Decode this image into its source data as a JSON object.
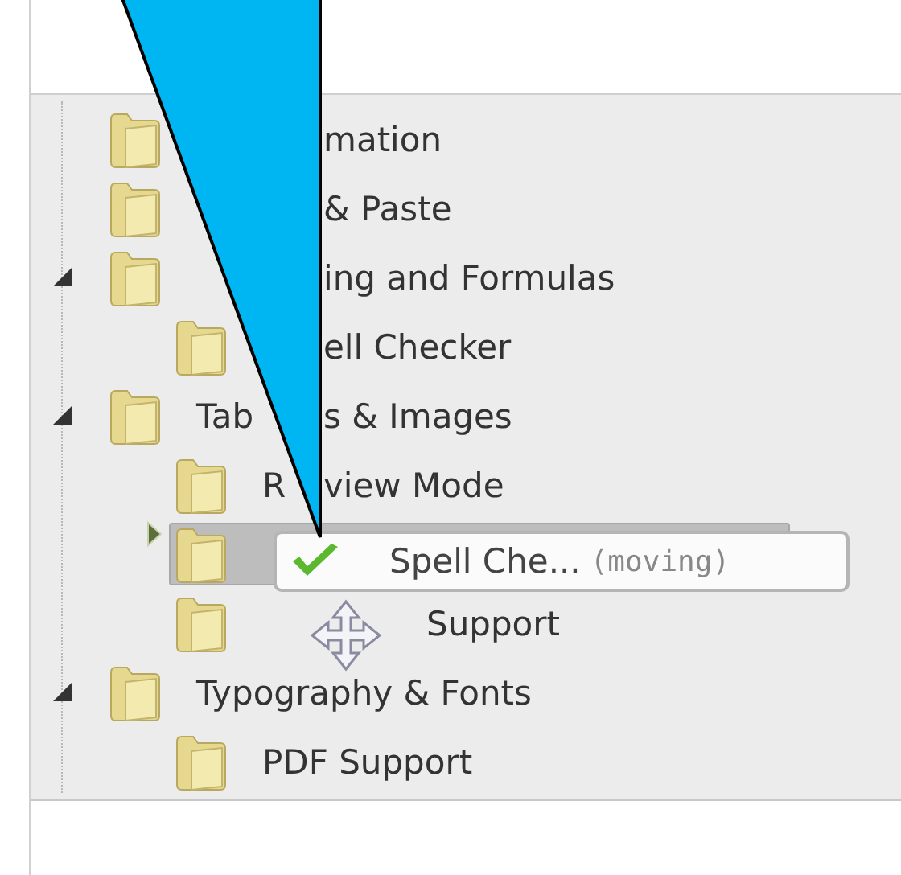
{
  "tree": {
    "items": [
      {
        "selected": false,
        "parts": [
          {
            "text": "mation",
            "kind": "tail"
          }
        ]
      },
      {
        "selected": false,
        "parts": [
          {
            "text": "& Paste",
            "kind": "tail"
          }
        ]
      },
      {
        "selected": false,
        "expanded": true,
        "parts": [
          {
            "text": "ing and Formulas",
            "kind": "tail"
          }
        ],
        "children": [
          {
            "selected": false,
            "parts": [
              {
                "text": "ell Checker",
                "kind": "tail"
              }
            ]
          }
        ]
      },
      {
        "selected": false,
        "expanded": true,
        "parts": [
          {
            "text": "Tab",
            "kind": "head"
          },
          {
            "text": "s & Images",
            "kind": "tail"
          }
        ],
        "children": [
          {
            "selected": false,
            "parts": [
              {
                "text": "R",
                "kind": "head"
              },
              {
                "text": "view Mode",
                "kind": "tail"
              }
            ]
          },
          {
            "selected": true
          },
          {
            "selected": false,
            "parts": [
              {
                "text": "Support",
                "kind": "end"
              }
            ]
          }
        ]
      },
      {
        "selected": false,
        "expanded": true,
        "parts": [
          {
            "text": "Typography & Fonts",
            "kind": "head"
          }
        ],
        "children": [
          {
            "selected": false,
            "parts": [
              {
                "text": "PDF Support",
                "kind": "head"
              }
            ]
          }
        ]
      }
    ]
  },
  "drag_tooltip": {
    "label": "Spell Che...",
    "status": "(moving)"
  }
}
